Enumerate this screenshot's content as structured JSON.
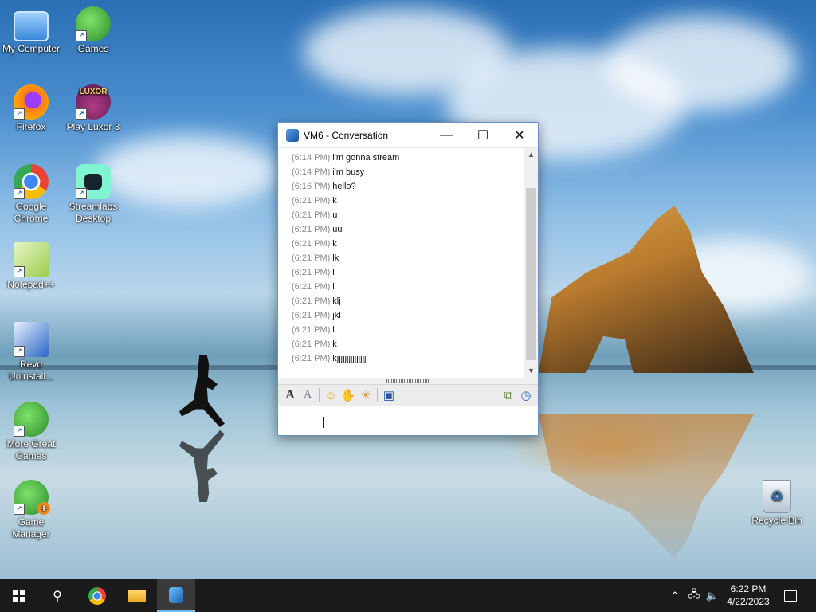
{
  "desktop": {
    "icons": [
      {
        "label": "My Computer"
      },
      {
        "label": "Games"
      },
      {
        "label": "Firefox"
      },
      {
        "label": "Play Luxor 3"
      },
      {
        "label": "Google Chrome"
      },
      {
        "label": "Streamlabs Desktop"
      },
      {
        "label": "Notepad++"
      },
      {
        "label": "Revo Uninstall..."
      },
      {
        "label": "More Great Games"
      },
      {
        "label": "Game Manager"
      },
      {
        "label": "Recycle Bin"
      }
    ],
    "luxor_logo_text": "LUXOR"
  },
  "window": {
    "title": "VM6 - Conversation",
    "messages": [
      {
        "time": "(6:14 PM)",
        "text": "i'm gonna stream"
      },
      {
        "time": "(6:14 PM)",
        "text": "i'm busy"
      },
      {
        "time": "(6:16 PM)",
        "text": "hello?"
      },
      {
        "time": "(6:21 PM)",
        "text": "k"
      },
      {
        "time": "(6:21 PM)",
        "text": "u"
      },
      {
        "time": "(6:21 PM)",
        "text": "uu"
      },
      {
        "time": "(6:21 PM)",
        "text": "k"
      },
      {
        "time": "(6:21 PM)",
        "text": "lk"
      },
      {
        "time": "(6:21 PM)",
        "text": "l"
      },
      {
        "time": "(6:21 PM)",
        "text": "l"
      },
      {
        "time": "(6:21 PM)",
        "text": "klj"
      },
      {
        "time": "(6:21 PM)",
        "text": "jkl"
      },
      {
        "time": "(6:21 PM)",
        "text": "l"
      },
      {
        "time": "(6:21 PM)",
        "text": "k"
      },
      {
        "time": "(6:21 PM)",
        "text": "kjjjjjjjjjjjjjjj"
      }
    ],
    "input_value": "",
    "toolbar_icons": [
      "font-icon",
      "font-color-icon",
      "emoticon-icon",
      "nudge-icon",
      "wink-icon",
      "save-icon",
      "send-file-icon",
      "history-icon"
    ]
  },
  "taskbar": {
    "time": "6:22 PM",
    "date": "4/22/2023"
  },
  "colors": {
    "accent": "#77b7f0",
    "taskbar": "#1b1b1b",
    "timestamp": "#8a8a8a"
  }
}
